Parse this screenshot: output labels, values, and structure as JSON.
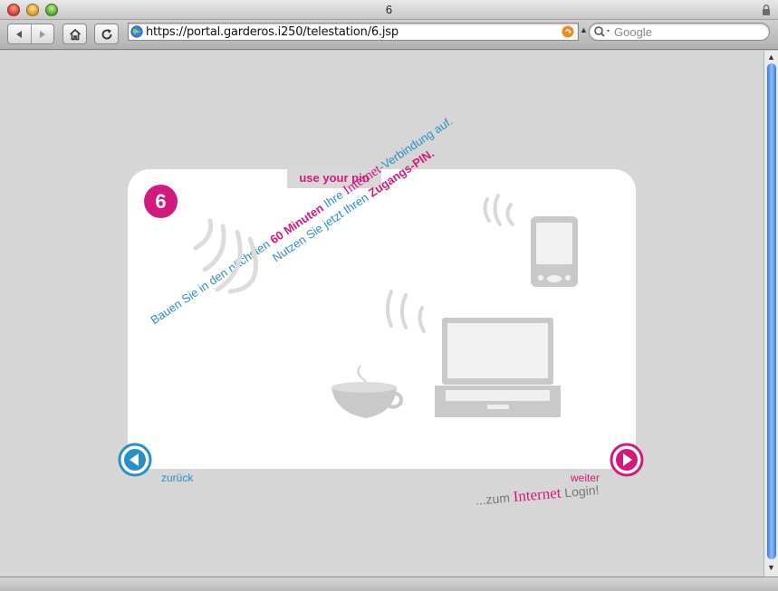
{
  "window": {
    "title": "6"
  },
  "toolbar": {
    "url": "https://portal.garderos.i250/telestation/6.jsp",
    "search_placeholder": "Google"
  },
  "card": {
    "tab_label": "use your pin",
    "step": "6",
    "instruction": {
      "line1_a": "Bauen Sie in den nächsten ",
      "line1_bold": "60 Minuten",
      "line1_b": " Ihre ",
      "line1_net": "Internet",
      "line1_c": "-Verbindung auf.",
      "line2_a": "Nutzen Sie jetzt Ihren ",
      "line2_bold": "Zugangs-PIN."
    },
    "login": {
      "prefix": "...zum ",
      "net": "Internet",
      "suffix": " Login!"
    }
  },
  "nav": {
    "back_label": "zurück",
    "next_label": "weiter"
  },
  "colors": {
    "magenta": "#d4197e",
    "blue": "#2a8fc9"
  },
  "icons": [
    "back-icon",
    "forward-icon",
    "home-icon",
    "reload-icon",
    "globe-icon",
    "rss-icon",
    "search-icon",
    "lock-icon"
  ]
}
